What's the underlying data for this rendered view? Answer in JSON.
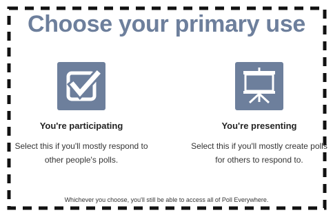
{
  "colors": {
    "accent": "#6d7f9c",
    "border": "#111111",
    "text": "#222222",
    "background": "#ffffff"
  },
  "header": {
    "title": "Choose your primary use"
  },
  "options": [
    {
      "icon": "checkbox-check-icon",
      "title": "You're participating",
      "description": "Select this if you'll mostly respond to other people's polls."
    },
    {
      "icon": "presentation-screen-icon",
      "title": "You're presenting",
      "description": "Select this if you'll mostly create polls for others to respond to."
    }
  ],
  "footer": {
    "note": "Whichever you choose, you'll still be able to access all of Poll Everywhere."
  }
}
